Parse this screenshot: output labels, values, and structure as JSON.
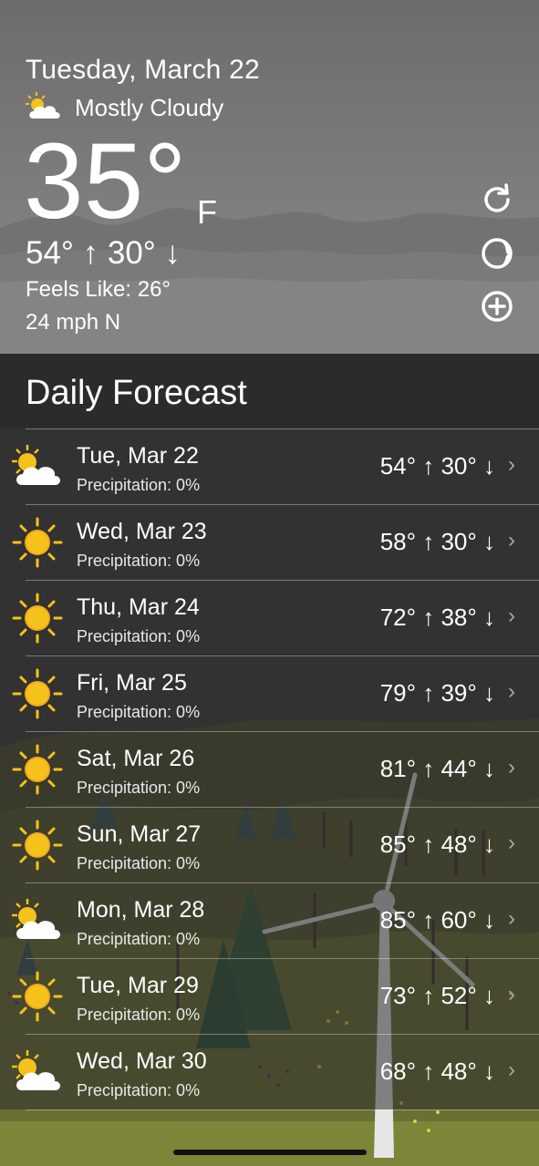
{
  "current": {
    "date": "Tuesday, March 22",
    "condition": "Mostly Cloudy",
    "condition_icon": "sun-cloud-icon",
    "temperature": "35°",
    "unit": "F",
    "high_low": "54° ↑ 30° ↓",
    "feels_like": "Feels Like: 26°",
    "wind": "24 mph N"
  },
  "actions": {
    "refresh_icon": "refresh-icon",
    "moon_icon": "moon-phase-icon",
    "add_icon": "add-location-icon"
  },
  "forecast": {
    "title": "Daily Forecast",
    "days": [
      {
        "day": "Tue, Mar 22",
        "precip": "Precipitation: 0%",
        "temps": "54° ↑ 30° ↓",
        "icon": "sun-cloud-icon"
      },
      {
        "day": "Wed, Mar 23",
        "precip": "Precipitation: 0%",
        "temps": "58° ↑ 30° ↓",
        "icon": "sun-icon"
      },
      {
        "day": "Thu, Mar 24",
        "precip": "Precipitation: 0%",
        "temps": "72° ↑ 38° ↓",
        "icon": "sun-icon"
      },
      {
        "day": "Fri, Mar 25",
        "precip": "Precipitation: 0%",
        "temps": "79° ↑ 39° ↓",
        "icon": "sun-icon"
      },
      {
        "day": "Sat, Mar 26",
        "precip": "Precipitation: 0%",
        "temps": "81° ↑ 44° ↓",
        "icon": "sun-icon"
      },
      {
        "day": "Sun, Mar 27",
        "precip": "Precipitation: 0%",
        "temps": "85° ↑ 48° ↓",
        "icon": "sun-icon"
      },
      {
        "day": "Mon, Mar 28",
        "precip": "Precipitation: 0%",
        "temps": "85° ↑ 60° ↓",
        "icon": "sun-cloud-icon"
      },
      {
        "day": "Tue, Mar 29",
        "precip": "Precipitation: 0%",
        "temps": "73° ↑ 52° ↓",
        "icon": "sun-icon"
      },
      {
        "day": "Wed, Mar 30",
        "precip": "Precipitation: 0%",
        "temps": "68° ↑ 48° ↓",
        "icon": "sun-cloud-icon"
      }
    ]
  },
  "colors": {
    "sun": "#f5c21b",
    "cloud": "#ffffff",
    "header_bg": "#7a7a7a",
    "panel_bg": "#2b2b2b"
  }
}
